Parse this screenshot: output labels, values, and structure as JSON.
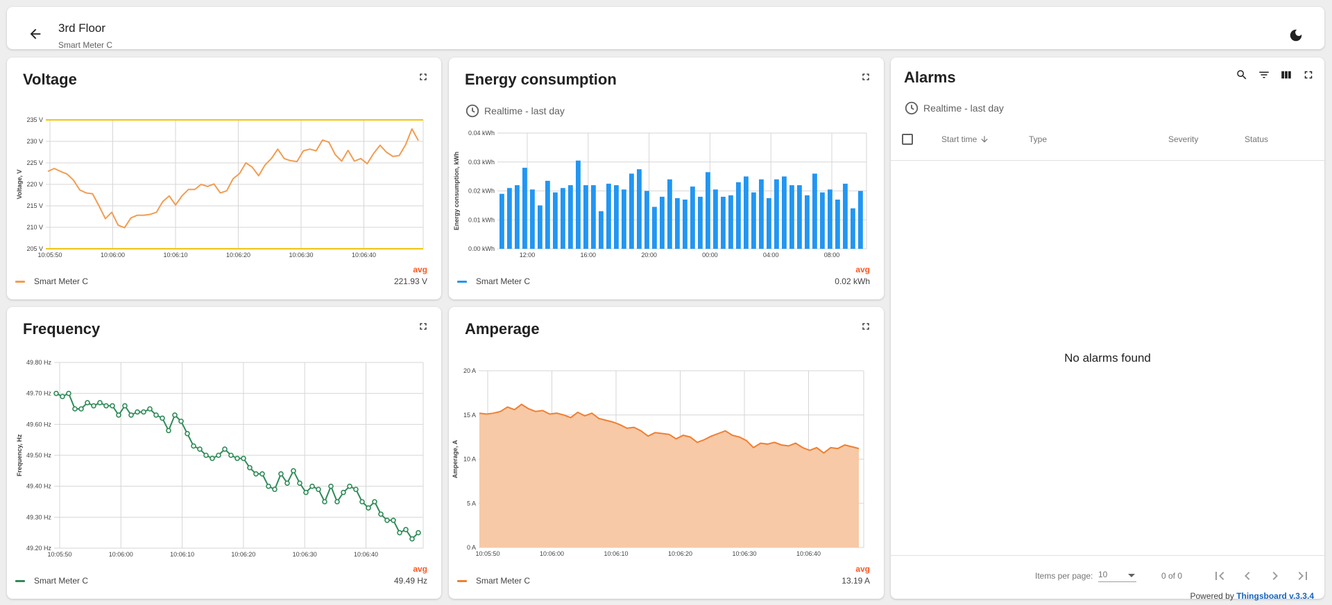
{
  "header": {
    "title": "3rd Floor",
    "subtitle": "Smart Meter C"
  },
  "colors": {
    "voltage": "#f39c50",
    "energy": "#2196f3",
    "frequency": "#2e8b57",
    "amperage": "#ef7f32",
    "amperage_fill": "#f7c9a6",
    "threshold": "#f1c40f",
    "avg": "#ff5722"
  },
  "icons": [
    "arrow-back-icon",
    "dark-mode-icon",
    "fullscreen-icon",
    "clock-icon",
    "search-icon",
    "filter-icon",
    "columns-icon",
    "sort-down-icon",
    "first-page-icon",
    "prev-page-icon",
    "next-page-icon",
    "last-page-icon"
  ],
  "voltage": {
    "title": "Voltage",
    "legend": {
      "avg_label": "avg",
      "name": "Smart Meter C",
      "value": "221.93 V"
    },
    "chart_data": {
      "type": "line",
      "ylabel": "Voltage, V",
      "ylim": [
        205,
        235
      ],
      "yticks": [
        "205 V",
        "210 V",
        "215 V",
        "220 V",
        "225 V",
        "230 V",
        "235 V"
      ],
      "xticks": [
        "10:05:50",
        "10:06:00",
        "10:06:10",
        "10:06:20",
        "10:06:30",
        "10:06:40"
      ],
      "x": [
        0,
        1,
        2,
        3,
        4,
        5,
        6,
        7,
        8,
        9,
        10,
        11,
        12,
        13,
        14,
        15,
        16,
        17,
        18,
        19,
        20,
        21,
        22,
        23,
        24,
        25,
        26,
        27,
        28,
        29,
        30,
        31,
        32,
        33,
        34,
        35,
        36,
        37,
        38,
        39,
        40,
        41,
        42,
        43,
        44,
        45,
        46,
        47,
        48,
        49,
        50,
        51,
        52,
        53,
        54,
        55,
        56,
        57,
        58
      ],
      "values": [
        223,
        223.7,
        223,
        222.4,
        221,
        218.7,
        218.0,
        217.8,
        215,
        212,
        213.5,
        210.5,
        209.9,
        212.2,
        212.8,
        212.8,
        213,
        213.5,
        216,
        217.3,
        215.2,
        217.3,
        218.8,
        218.8,
        220,
        219.5,
        220.1,
        218,
        218.5,
        221.3,
        222.5,
        225,
        224,
        222,
        224.5,
        226.0,
        228.2,
        226,
        225.5,
        225.3,
        227.8,
        228.2,
        227.8,
        230.3,
        229.8,
        226.9,
        225.4,
        227.9,
        225.4,
        226.0,
        224.8,
        227.2,
        229.1,
        227.5,
        226.5,
        226.7,
        229.2,
        232.9,
        230.2
      ],
      "threshold": [
        205,
        235
      ]
    }
  },
  "energy": {
    "title": "Energy consumption",
    "timewindow": "Realtime - last day",
    "legend": {
      "avg_label": "avg",
      "name": "Smart Meter C",
      "value": "0.02 kWh"
    },
    "chart_data": {
      "type": "bar",
      "ylabel": "Energy consumption, kWh",
      "ylim": [
        0,
        0.04
      ],
      "yticks": [
        "0.00 kWh",
        "0.01 kWh",
        "0.02 kWh",
        "0.03 kWh",
        "0.04 kWh"
      ],
      "xticks": [
        "12:00",
        "16:00",
        "20:00",
        "00:00",
        "04:00",
        "08:00"
      ],
      "values": [
        0.019,
        0.021,
        0.022,
        0.028,
        0.0205,
        0.015,
        0.0235,
        0.0195,
        0.021,
        0.022,
        0.0305,
        0.022,
        0.022,
        0.013,
        0.0225,
        0.022,
        0.0205,
        0.026,
        0.0275,
        0.02,
        0.0145,
        0.018,
        0.024,
        0.0175,
        0.017,
        0.0215,
        0.018,
        0.0265,
        0.0205,
        0.018,
        0.0185,
        0.023,
        0.025,
        0.0195,
        0.024,
        0.0175,
        0.024,
        0.025,
        0.022,
        0.022,
        0.0185,
        0.026,
        0.0195,
        0.0205,
        0.017,
        0.0225,
        0.014,
        0.02
      ]
    }
  },
  "frequency": {
    "title": "Frequency",
    "legend": {
      "avg_label": "avg",
      "name": "Smart Meter C",
      "value": "49.49 Hz"
    },
    "chart_data": {
      "type": "line",
      "ylabel": "Frequency, Hz",
      "ylim": [
        49.2,
        49.8
      ],
      "yticks": [
        "49.20 Hz",
        "49.30 Hz",
        "49.40 Hz",
        "49.50 Hz",
        "49.60 Hz",
        "49.70 Hz",
        "49.80 Hz"
      ],
      "xticks": [
        "10:05:50",
        "10:06:00",
        "10:06:10",
        "10:06:20",
        "10:06:30",
        "10:06:40"
      ],
      "values": [
        49.7,
        49.69,
        49.7,
        49.65,
        49.65,
        49.67,
        49.66,
        49.67,
        49.66,
        49.66,
        49.63,
        49.66,
        49.63,
        49.64,
        49.64,
        49.65,
        49.63,
        49.62,
        49.58,
        49.63,
        49.61,
        49.57,
        49.53,
        49.52,
        49.5,
        49.49,
        49.5,
        49.52,
        49.5,
        49.49,
        49.49,
        49.46,
        49.44,
        49.44,
        49.4,
        49.39,
        49.44,
        49.41,
        49.45,
        49.41,
        49.38,
        49.4,
        49.39,
        49.35,
        49.4,
        49.35,
        49.38,
        49.4,
        49.39,
        49.35,
        49.33,
        49.35,
        49.31,
        49.29,
        49.29,
        49.25,
        49.26,
        49.23,
        49.25
      ]
    }
  },
  "amperage": {
    "title": "Amperage",
    "legend": {
      "avg_label": "avg",
      "name": "Smart Meter C",
      "value": "13.19 A"
    },
    "chart_data": {
      "type": "area",
      "ylabel": "Amperage, A",
      "ylim": [
        0,
        20
      ],
      "yticks": [
        "0 A",
        "5 A",
        "10 A",
        "15 A",
        "20 A"
      ],
      "xticks": [
        "10:05:50",
        "10:06:00",
        "10:06:10",
        "10:06:20",
        "10:06:30",
        "10:06:40"
      ],
      "values": [
        15.2,
        15.1,
        15.2,
        15.4,
        15.9,
        15.6,
        16.2,
        15.7,
        15.4,
        15.5,
        15.1,
        15.2,
        15.0,
        14.7,
        15.3,
        14.9,
        15.2,
        14.6,
        14.4,
        14.2,
        13.9,
        13.5,
        13.6,
        13.2,
        12.6,
        13.0,
        12.9,
        12.8,
        12.3,
        12.7,
        12.5,
        11.9,
        12.2,
        12.6,
        12.9,
        13.2,
        12.7,
        12.5,
        12.1,
        11.3,
        11.8,
        11.7,
        11.9,
        11.6,
        11.5,
        11.8,
        11.3,
        11.0,
        11.3,
        10.7,
        11.3,
        11.2,
        11.6,
        11.4,
        11.2
      ]
    }
  },
  "alarms": {
    "title": "Alarms",
    "timewindow": "Realtime - last day",
    "columns": [
      "Start time",
      "Type",
      "Severity",
      "Status"
    ],
    "empty": "No alarms found",
    "items_per_page_label": "Items per page:",
    "items_per_page": "10",
    "range": "0 of 0",
    "powered_by": "Powered by",
    "powered_link": "Thingsboard v.3.3.4"
  }
}
